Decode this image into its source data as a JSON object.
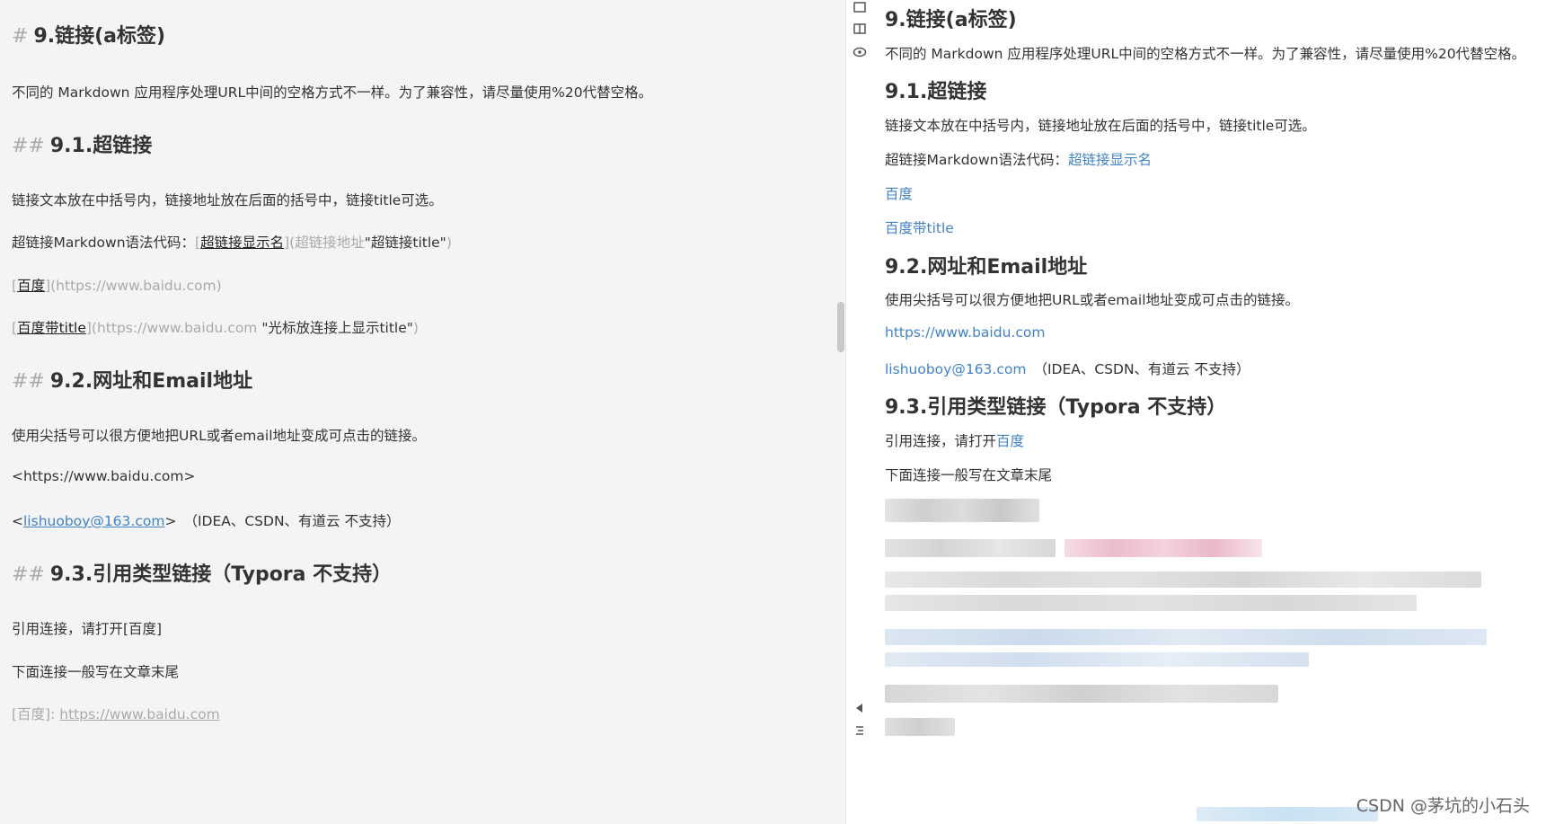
{
  "editor": {
    "h9_mark": "#",
    "h9_title": "9.链接(a标签)",
    "intro": "不同的 Markdown 应用程序处理URL中间的空格方式不一样。为了兼容性，请尽量使用%20代替空格。",
    "h91_mark": "##",
    "h91_title": "9.1.超链接",
    "p_desc": "链接文本放在中括号内，链接地址放在后面的括号中，链接title可选。",
    "syntax_prefix": "超链接Markdown语法代码：",
    "syntax_lb": "[",
    "syntax_text": "超链接显示名",
    "syntax_mid": "](超链接地址",
    "syntax_title": "\"超链接title\"",
    "syntax_rp": ")",
    "baidu_lb": "[",
    "baidu_text": "百度",
    "baidu_url": "](https://www.baidu.com)",
    "baidu2_lb": "[",
    "baidu2_text": "百度带title",
    "baidu2_url": "](https://www.baidu.com ",
    "baidu2_title": "\"光标放连接上显示title\"",
    "baidu2_rp": ")",
    "h92_mark": "##",
    "h92_title": "9.2.网址和Email地址",
    "p_angle": "使用尖括号可以很方便地把URL或者email地址变成可点击的链接。",
    "url_line": "<https://www.baidu.com>",
    "email_lt": "<",
    "email": "lishuoboy@163.com",
    "email_gt": ">",
    "email_note": "（IDEA、CSDN、有道云 不支持）",
    "h93_mark": "##",
    "h93_title": "9.3.引用类型链接（Typora 不支持）",
    "ref_line": "引用连接，请打开[百度]",
    "ref_note": "下面连接一般写在文章末尾",
    "ref_def_label": "[百度]: ",
    "ref_def_url": "https://www.baidu.com"
  },
  "toolbar": {
    "icons": [
      "sidebar-icon",
      "split-view-icon",
      "eye-icon",
      "collapse-icon",
      "outline-icon"
    ]
  },
  "preview": {
    "h9_title": "9.链接(a标签)",
    "intro": "不同的 Markdown 应用程序处理URL中间的空格方式不一样。为了兼容性，请尽量使用%20代替空格。",
    "h91_title": "9.1.超链接",
    "p_desc": "链接文本放在中括号内，链接地址放在后面的括号中，链接title可选。",
    "syntax_prefix": "超链接Markdown语法代码：",
    "syntax_link": "超链接显示名",
    "baidu": "百度",
    "baidu_title": "百度带title",
    "h92_title": "9.2.网址和Email地址",
    "p_angle": "使用尖括号可以很方便地把URL或者email地址变成可点击的链接。",
    "url": "https://www.baidu.com",
    "email": "lishuoboy@163.com",
    "email_note": "（IDEA、CSDN、有道云 不支持）",
    "h93_title": "9.3.引用类型链接（Typora 不支持）",
    "ref_prefix": "引用连接，请打开",
    "ref_link": "百度",
    "ref_note": "下面连接一般写在文章末尾"
  },
  "watermark": "CSDN @茅坑的小石头",
  "colors": {
    "link": "#4183c4",
    "editor_bg": "#f4f4f4",
    "mark_gray": "#aaaaaa"
  }
}
